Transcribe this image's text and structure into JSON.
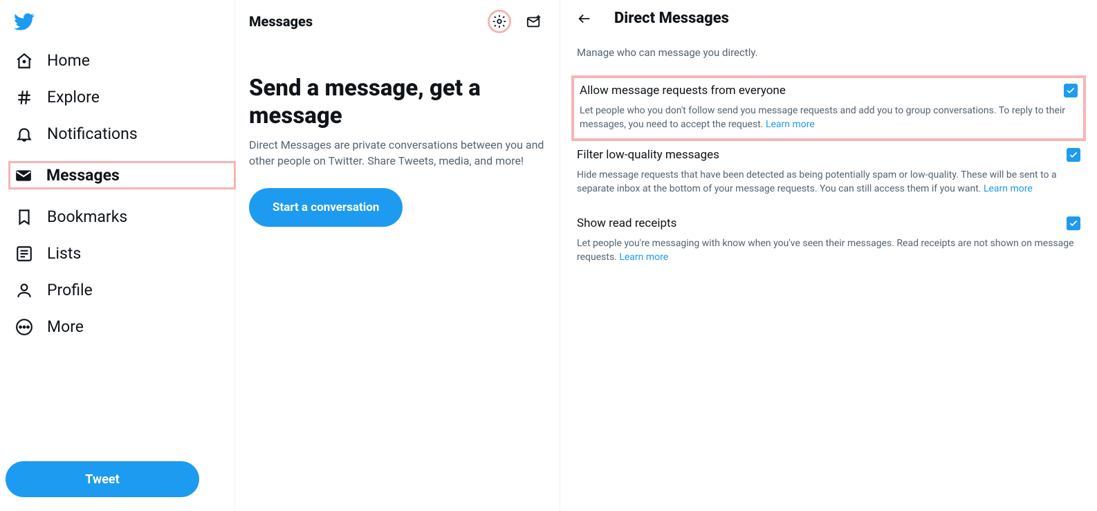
{
  "sidebar": {
    "items": [
      {
        "label": "Home"
      },
      {
        "label": "Explore"
      },
      {
        "label": "Notifications"
      },
      {
        "label": "Messages"
      },
      {
        "label": "Bookmarks"
      },
      {
        "label": "Lists"
      },
      {
        "label": "Profile"
      },
      {
        "label": "More"
      }
    ],
    "tweet_label": "Tweet"
  },
  "messages": {
    "header": "Messages",
    "empty_title": "Send a message, get a message",
    "empty_desc": "Direct Messages are private conversations between you and other people on Twitter. Share Tweets, media, and more!",
    "start_btn": "Start a conversation"
  },
  "settings": {
    "title": "Direct Messages",
    "subtitle": "Manage who can message you directly.",
    "learn_more": "Learn more",
    "options": [
      {
        "title": "Allow message requests from everyone",
        "desc": "Let people who you don't follow send you message requests and add you to group conversations. To reply to their messages, you need to accept the request. "
      },
      {
        "title": "Filter low-quality messages",
        "desc": "Hide message requests that have been detected as being potentially spam or low-quality. These will be sent to a separate inbox at the bottom of your message requests. You can still access them if you want. "
      },
      {
        "title": "Show read receipts",
        "desc": "Let people you're messaging with know when you've seen their messages. Read receipts are not shown on message requests. "
      }
    ]
  }
}
